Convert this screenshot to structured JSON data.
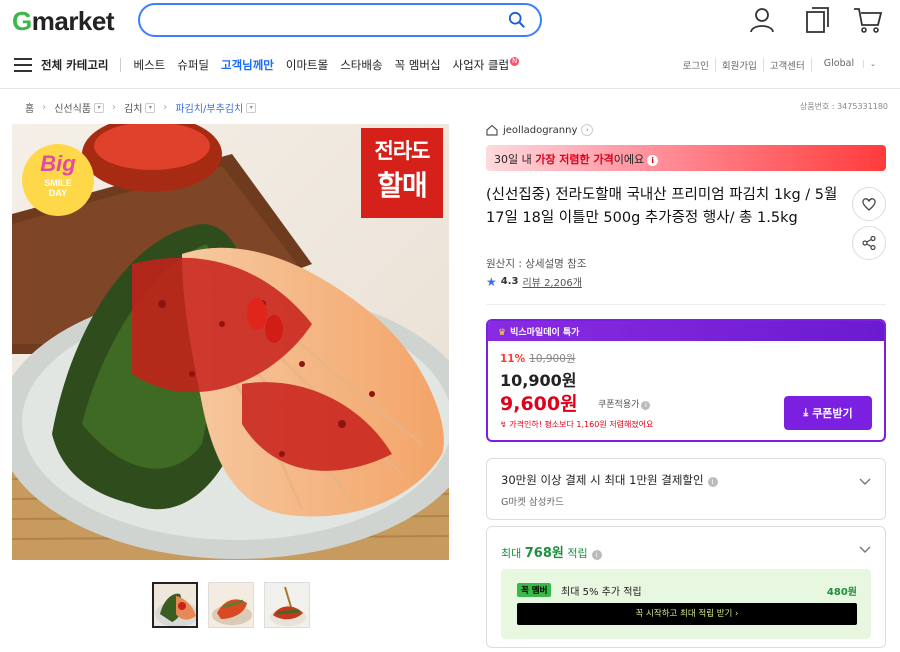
{
  "header": {
    "logo_g": "G",
    "logo_rest": "market",
    "search": {
      "placeholder": "",
      "icon": "search-icon"
    },
    "icons": [
      "user-icon",
      "copy-icon",
      "cart-icon"
    ]
  },
  "nav": {
    "all_categories": "전체 카테고리",
    "items": [
      "베스트",
      "슈퍼딜",
      "고객님께만",
      "이마트몰",
      "스타배송",
      "꼭 멤버십",
      "사업자 클럽"
    ],
    "new_mark": "N",
    "util": [
      "로그인",
      "회원가입",
      "고객센터",
      "Global"
    ]
  },
  "breadcrumb": {
    "items": [
      "홈",
      "신선식품",
      "김치",
      "파김치/부추김치"
    ],
    "product_no": "상품번호 : 3475331180"
  },
  "image": {
    "badge_big": "Big",
    "badge_sub": "SMILE",
    "badge_day": "DAY",
    "stamp_line1": "전라도",
    "stamp_line2": "할매"
  },
  "product": {
    "store": "jeolladogranny",
    "price_banner_pre": "30일 내 ",
    "price_banner_bold": "가장 저렴한 가격",
    "price_banner_post": "이에요",
    "title": "(신선집중) 전라도할매 국내산 프리미엄 파김치 1kg / 5월 17일 18일 이틀만 500g 추가증정 행사/ 총 1.5kg",
    "origin": "원산지 : 상세설명 참조",
    "rating": "4.3",
    "reviews": "리뷰 2,206개"
  },
  "promo": {
    "header": "빅스마일데이 특가",
    "discount": "11%",
    "original": "10,900원",
    "price": "10,900원",
    "coupon_price": "9,600원",
    "coupon_label": "쿠폰적용가",
    "note": "가격인하! 평소보다 1,160원 저렴해졌어요",
    "coupon_button": "쿠폰받기"
  },
  "card_payment": {
    "title": "30만원 이상 결제 시 최대 1만원 결제할인",
    "sub": "G마켓 삼성카드"
  },
  "card_points": {
    "title_pre": "최대 ",
    "title_amt": "768원",
    "title_post": " 적립",
    "badge": "꼭 멤버",
    "member_text": "최대 5% 추가 적립",
    "member_amount": "480원",
    "bar_text": "꼭 시작하고 최대 적립 받기 ›"
  }
}
